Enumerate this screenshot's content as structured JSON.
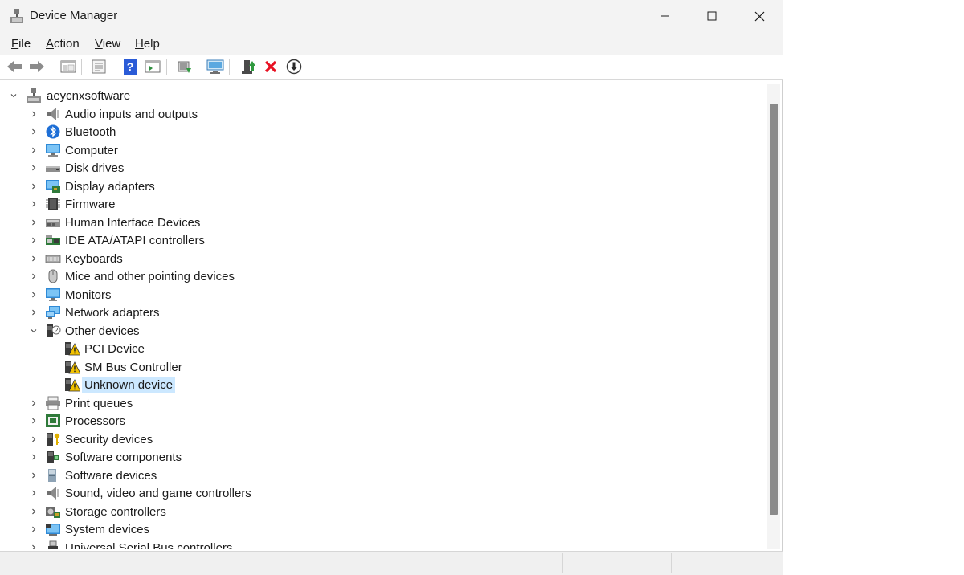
{
  "window": {
    "title": "Device Manager"
  },
  "menu": {
    "file": "File",
    "action": "Action",
    "view": "View",
    "help": "Help"
  },
  "tree": {
    "root": "aeycnxsoftware",
    "categories": [
      {
        "label": "Audio inputs and outputs",
        "icon": "speaker-icon"
      },
      {
        "label": "Bluetooth",
        "icon": "bluetooth-icon"
      },
      {
        "label": "Computer",
        "icon": "computer-icon"
      },
      {
        "label": "Disk drives",
        "icon": "disk-drive-icon"
      },
      {
        "label": "Display adapters",
        "icon": "display-adapter-icon"
      },
      {
        "label": "Firmware",
        "icon": "firmware-chip-icon"
      },
      {
        "label": "Human Interface Devices",
        "icon": "hid-icon"
      },
      {
        "label": "IDE ATA/ATAPI controllers",
        "icon": "ide-controller-icon"
      },
      {
        "label": "Keyboards",
        "icon": "keyboard-icon"
      },
      {
        "label": "Mice and other pointing devices",
        "icon": "mouse-icon"
      },
      {
        "label": "Monitors",
        "icon": "monitor-icon"
      },
      {
        "label": "Network adapters",
        "icon": "network-adapter-icon"
      },
      {
        "label": "Other devices",
        "icon": "unknown-device-icon",
        "expanded": true,
        "children": [
          "PCI Device",
          "SM Bus Controller",
          "Unknown device"
        ]
      },
      {
        "label": "Print queues",
        "icon": "printer-icon"
      },
      {
        "label": "Processors",
        "icon": "processor-icon"
      },
      {
        "label": "Security devices",
        "icon": "security-device-icon"
      },
      {
        "label": "Software components",
        "icon": "software-component-icon"
      },
      {
        "label": "Software devices",
        "icon": "software-device-icon"
      },
      {
        "label": "Sound, video and game controllers",
        "icon": "sound-controller-icon"
      },
      {
        "label": "Storage controllers",
        "icon": "storage-controller-icon"
      },
      {
        "label": "System devices",
        "icon": "system-devices-icon"
      },
      {
        "label": "Universal Serial Bus controllers",
        "icon": "usb-icon"
      }
    ],
    "selected": "Unknown device"
  },
  "colors": {
    "selection": "#cce8ff",
    "warning": "#f2c200",
    "remove": "#e81123",
    "scroll_thumb": "#8a8a8a"
  }
}
